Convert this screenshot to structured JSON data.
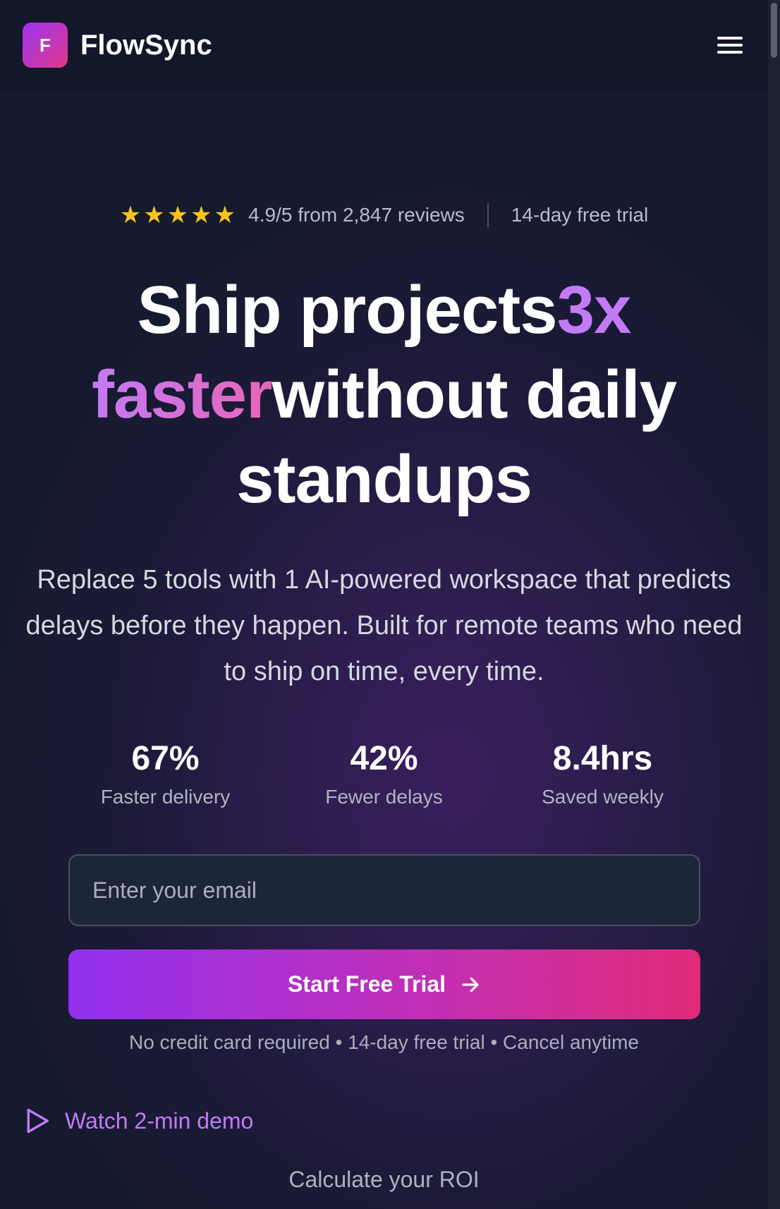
{
  "header": {
    "logo_letter": "F",
    "brand": "FlowSync"
  },
  "rating": {
    "stars": 5,
    "text": "4.9/5 from 2,847 reviews",
    "trial_note": "14-day free trial"
  },
  "headline": {
    "part1": "Ship projects",
    "accent1": "3x",
    "accent2": "faster",
    "part2": "without daily",
    "part3": "standups"
  },
  "subtext": "Replace 5 tools with 1 AI-powered workspace that predicts delays before they happen. Built for remote teams who need to ship on time, every time.",
  "stats": [
    {
      "value": "67%",
      "label": "Faster delivery"
    },
    {
      "value": "42%",
      "label": "Fewer delays"
    },
    {
      "value": "8.4hrs",
      "label": "Saved weekly"
    }
  ],
  "email": {
    "placeholder": "Enter your email",
    "value": ""
  },
  "cta": {
    "label": "Start Free Trial"
  },
  "fineprint": "No credit card required • 14-day free trial • Cancel anytime",
  "demo_link": "Watch 2-min demo",
  "roi_link": "Calculate your ROI",
  "colors": {
    "accent": "#c27af5",
    "cta_start": "#9130ef",
    "cta_end": "#e12a78",
    "star": "#f6c21c"
  }
}
